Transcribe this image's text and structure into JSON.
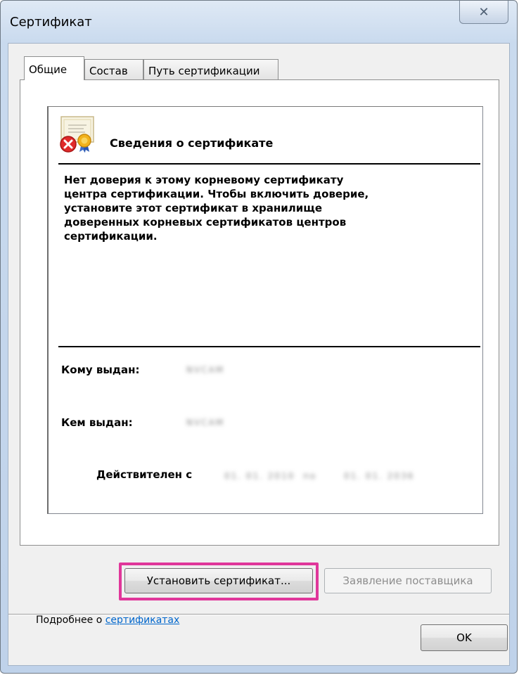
{
  "window": {
    "title": "Сертификат",
    "close_glyph": "✕"
  },
  "tabs": [
    {
      "label": "Общие",
      "active": true
    },
    {
      "label": "Состав",
      "active": false
    },
    {
      "label": "Путь сертификации",
      "active": false
    }
  ],
  "certificate": {
    "heading": "Сведения о сертификате",
    "warning_lines": [
      "Нет доверия к этому корневому сертификату",
      "центра сертификации. Чтобы включить  доверие,",
      "установите этот сертификат в хранилище",
      "доверенных корневых сертификатов центров",
      "сертификации."
    ],
    "issued_to_label": "Кому выдан:",
    "issued_to_value": "NVCAM",
    "issued_by_label": "Кем выдан:",
    "issued_by_value": "NVCAM",
    "valid_from_label": "Действителен с",
    "valid_from_value": "01. 01. 2010",
    "valid_to_label": "по",
    "valid_to_value": "01. 01. 2036",
    "icon": "certificate-error-icon"
  },
  "buttons": {
    "install": "Установить сертификат...",
    "issuer_statement": "Заявление поставщика",
    "ok": "OK"
  },
  "more_info": {
    "prefix": "Подробнее о ",
    "link": "сертификатах"
  },
  "colors": {
    "highlight": "#e0379a",
    "link": "#0066cc"
  }
}
